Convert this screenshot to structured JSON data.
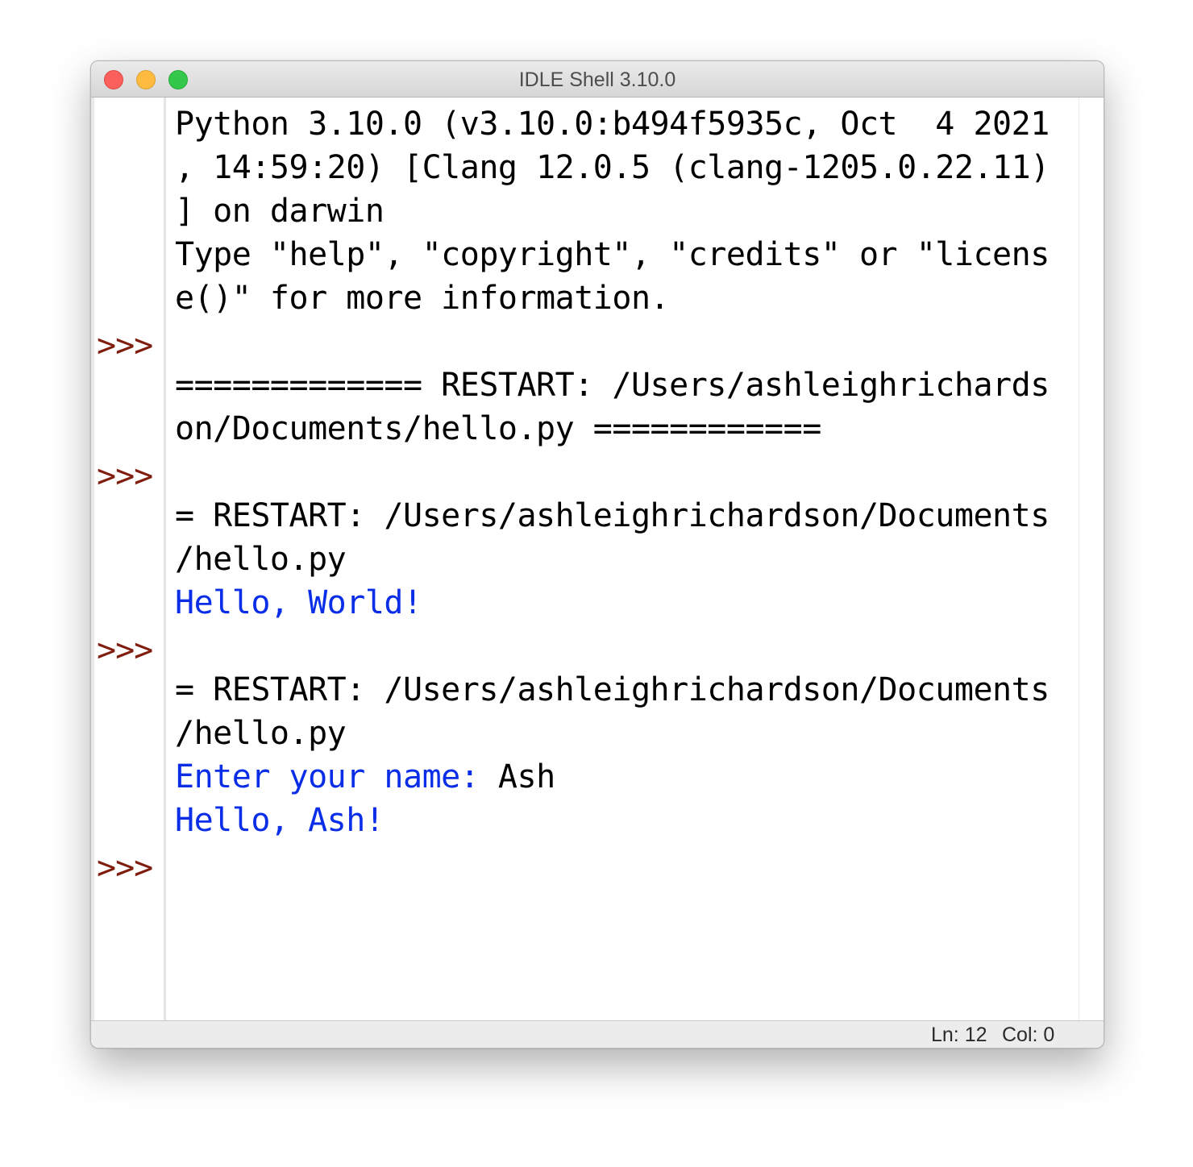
{
  "window": {
    "title": "IDLE Shell 3.10.0"
  },
  "shell": {
    "prompt": ">>>",
    "lines": [
      {
        "text": "Python 3.10.0 (v3.10.0:b494f5935c, Oct  4 2021"
      },
      {
        "text": ", 14:59:20) [Clang 12.0.5 (clang-1205.0.22.11)"
      },
      {
        "text": "] on darwin"
      },
      {
        "text": "Type \"help\", \"copyright\", \"credits\" or \"licens"
      },
      {
        "text": "e()\" for more information."
      },
      {
        "text": ""
      },
      {
        "text": "============= RESTART: /Users/ashleighrichards"
      },
      {
        "text": "on/Documents/hello.py ============"
      },
      {
        "text": ""
      },
      {
        "text": "= RESTART: /Users/ashleighrichardson/Documents"
      },
      {
        "text": "/hello.py"
      },
      {
        "text": "Hello, World!"
      },
      {
        "text": ""
      },
      {
        "text": "= RESTART: /Users/ashleighrichardson/Documents"
      },
      {
        "text": "/hello.py"
      },
      {
        "input_prompt": "Enter your name: ",
        "input_value": "Ash"
      },
      {
        "text": "Hello, Ash!"
      }
    ]
  },
  "status": {
    "line": "Ln: 12",
    "column": "Col: 0"
  },
  "colors": {
    "prompt": "#7f1d0e",
    "stdout": "#0a2ee8",
    "text": "#000000"
  }
}
